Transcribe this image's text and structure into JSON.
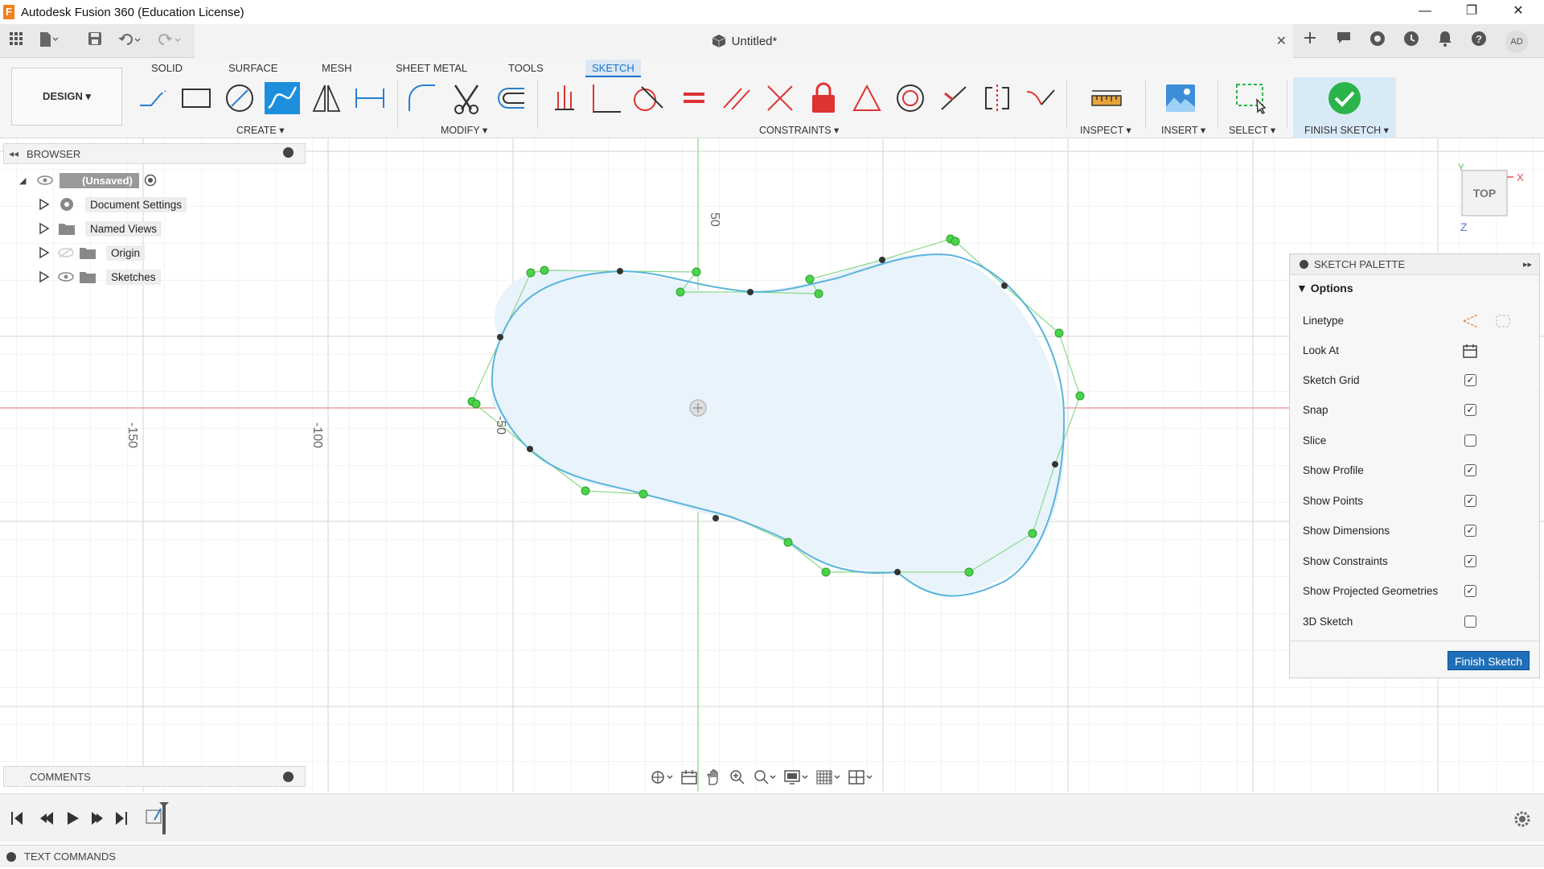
{
  "app": {
    "logo_letter": "F",
    "title": "Autodesk Fusion 360 (Education License)"
  },
  "window": {
    "minimize": "—",
    "maximize": "❐",
    "close": "✕"
  },
  "document": {
    "title": "Untitled*",
    "close": "✕"
  },
  "user": {
    "initials": "AD"
  },
  "workspace": {
    "label": "DESIGN ▾"
  },
  "tabs": [
    "SOLID",
    "SURFACE",
    "MESH",
    "SHEET METAL",
    "TOOLS",
    "SKETCH"
  ],
  "groups": {
    "create": "CREATE ▾",
    "modify": "MODIFY ▾",
    "constraints": "CONSTRAINTS ▾",
    "inspect": "INSPECT ▾",
    "insert": "INSERT ▾",
    "select": "SELECT ▾",
    "finish": "FINISH SKETCH ▾"
  },
  "browser": {
    "title": "BROWSER",
    "root": "(Unsaved)",
    "items": [
      "Document Settings",
      "Named Views",
      "Origin",
      "Sketches"
    ]
  },
  "axis_labels": {
    "v50": "50",
    "h150": "-150",
    "h100": "-100",
    "h50": "-50"
  },
  "viewcube": {
    "face": "TOP",
    "x": "X",
    "y": "Y",
    "z": "Z"
  },
  "palette": {
    "title": "SKETCH PALETTE",
    "section": "▼ Options",
    "options": [
      {
        "label": "Linetype"
      },
      {
        "label": "Look At"
      },
      {
        "label": "Sketch Grid",
        "checked": true
      },
      {
        "label": "Snap",
        "checked": true
      },
      {
        "label": "Slice",
        "checked": false
      },
      {
        "label": "Show Profile",
        "checked": true
      },
      {
        "label": "Show Points",
        "checked": true
      },
      {
        "label": "Show Dimensions",
        "checked": true
      },
      {
        "label": "Show Constraints",
        "checked": true
      },
      {
        "label": "Show Projected Geometries",
        "checked": true
      },
      {
        "label": "3D Sketch",
        "checked": false
      }
    ],
    "finish_button": "Finish Sketch"
  },
  "comments": {
    "title": "COMMENTS"
  },
  "text_commands": "TEXT COMMANDS",
  "colors": {
    "accent": "#1d8fdc",
    "finish_green": "#2bb44a",
    "curve": "#5ab4dc",
    "handle": "#32c832"
  }
}
